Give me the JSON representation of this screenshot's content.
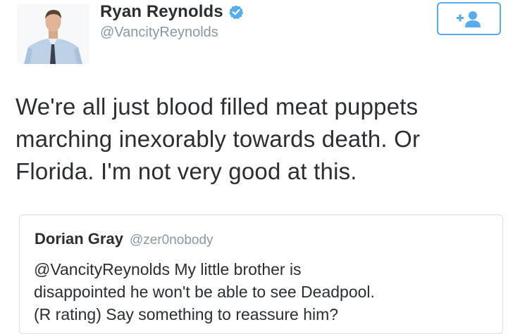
{
  "tweet": {
    "author": {
      "display_name": "Ryan Reynolds",
      "handle": "@VancityReynolds",
      "verified": true,
      "avatar_icon": "profile-photo"
    },
    "follow_button_icon": "follow-user-icon",
    "text_lines": [
      "We're all just blood filled meat puppets",
      "marching inexorably towards death. Or",
      "Florida. I'm not very good at this."
    ],
    "quoted_tweet": {
      "display_name": "Dorian Gray",
      "handle": "@zer0nobody",
      "text_lines": [
        "@VancityReynolds My little brother is",
        "disappointed he won't be able to see Deadpool.",
        "(R rating) Say something to reassure him?"
      ]
    }
  },
  "colors": {
    "accent": "#55acee",
    "verified": "#55acee",
    "text": "#292f33",
    "muted": "#8899a6",
    "card_border": "#d7dee3"
  }
}
